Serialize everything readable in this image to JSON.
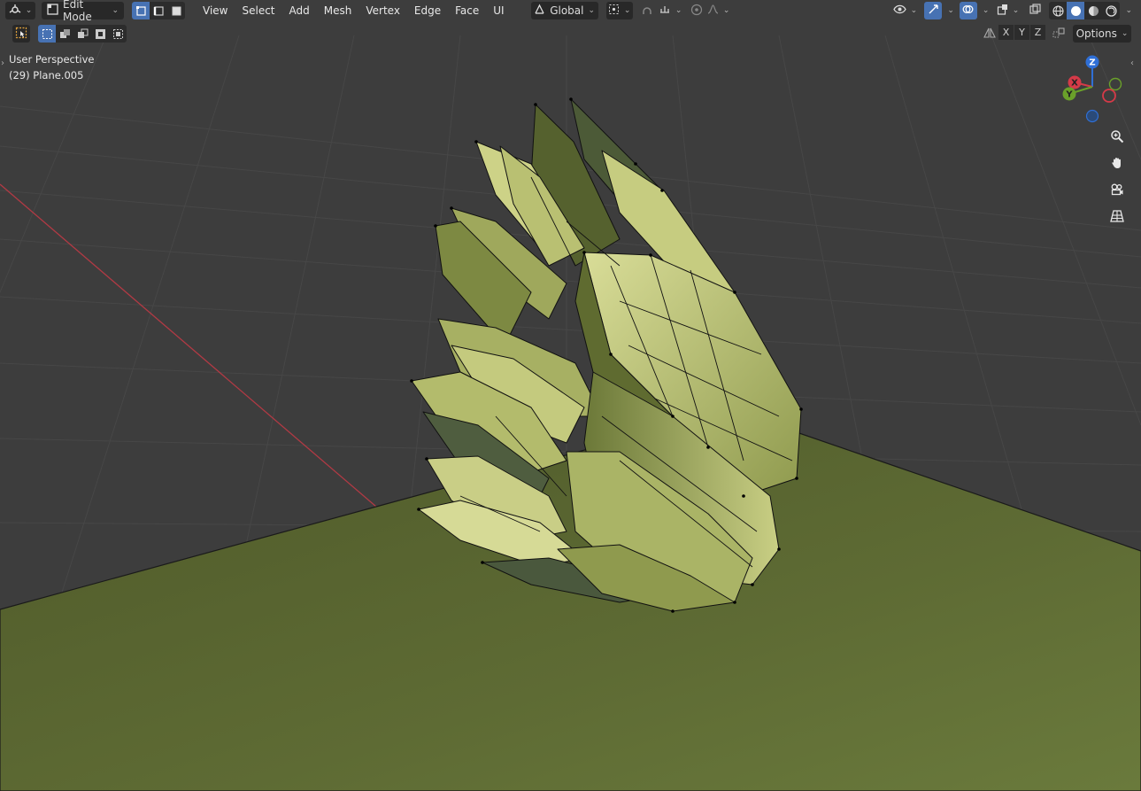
{
  "header": {
    "mode_label": "Edit Mode",
    "menus": [
      "View",
      "Select",
      "Add",
      "Mesh",
      "Vertex",
      "Edge",
      "Face",
      "UI"
    ],
    "orientation_label": "Global"
  },
  "toolbar": {
    "axis_labels": [
      "X",
      "Y",
      "Z"
    ],
    "options_label": "Options"
  },
  "viewport": {
    "view_name": "User Perspective",
    "object_info": "(29) Plane.005"
  },
  "gizmo": {
    "axes": [
      {
        "label": "Z",
        "color": "#2f6fd6"
      },
      {
        "label": "X",
        "color": "#d53a48"
      },
      {
        "label": "Y",
        "color": "#6aa02a"
      }
    ]
  },
  "colors": {
    "header_bg": "#303030",
    "viewport_bg": "#3d3d3d",
    "grid_line": "#474747",
    "x_axis_line": "#b13a44",
    "ground_plane": "#5d6a33",
    "mesh_light": "#cfd48a",
    "mesh_dark": "#4f5a2c",
    "mesh_shadow": "#3d4b4a",
    "accent": "#4772b3"
  },
  "icons": [
    "editor-type-icon",
    "vertex-select-icon",
    "edge-select-icon",
    "face-select-icon",
    "transform-pivot-icon",
    "snap-icon",
    "proportional-edit-icon",
    "visibility-icon",
    "gizmo-icon",
    "overlay-icon",
    "xray-icon",
    "wireframe-shading-icon",
    "solid-shading-icon",
    "material-shading-icon",
    "rendered-shading-icon",
    "zoom-icon",
    "pan-icon",
    "camera-icon",
    "grid-view-icon"
  ]
}
